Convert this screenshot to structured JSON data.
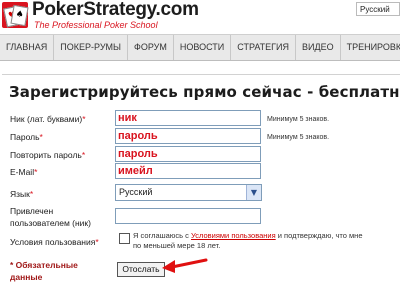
{
  "header": {
    "logo_name": "PokerStrategy.com",
    "logo_tagline": "The Professional Poker School",
    "logo_card_1": "♥",
    "logo_card_2": "♠",
    "language": "Русский"
  },
  "nav": {
    "items": [
      "ГЛАВНАЯ",
      "ПОКЕР-РУМЫ",
      "ФОРУМ",
      "НОВОСТИ",
      "СТРАТЕГИЯ",
      "ВИДЕО",
      "ТРЕНИРОВКИ"
    ]
  },
  "form": {
    "title": "Зарегистрируйтесь прямо сейчас - бесплатно",
    "nick_label": "Ник (лат. буквами)",
    "nick_value": "ник",
    "nick_hint": "Минимум 5 знаков.",
    "password_label": "Пароль",
    "password_value": "пароль",
    "password_hint": "Минимум 5 знаков.",
    "repeat_label": "Повторить пароль",
    "repeat_value": "пароль",
    "email_label": "E-Mail",
    "email_value": "имейл",
    "language_label": "Язык",
    "language_value": "Русский",
    "referrer_label_1": "Привлечен",
    "referrer_label_2": "пользователем (ник)",
    "terms_label": "Условия пользования",
    "terms_prefix": "Я соглашаюсь с ",
    "terms_link": "Условиями пользования",
    "terms_suffix": " и подтверждаю, что мне",
    "terms_line2": "по меньшей мере 18 лет.",
    "required_mark": "*",
    "required_note_1": "* Обязательные",
    "required_note_2": "данные",
    "submit_label": "Отослать"
  },
  "colors": {
    "accent": "#d9141f",
    "arrow": "#e01010",
    "nav_bg": "#e9e9e9"
  }
}
